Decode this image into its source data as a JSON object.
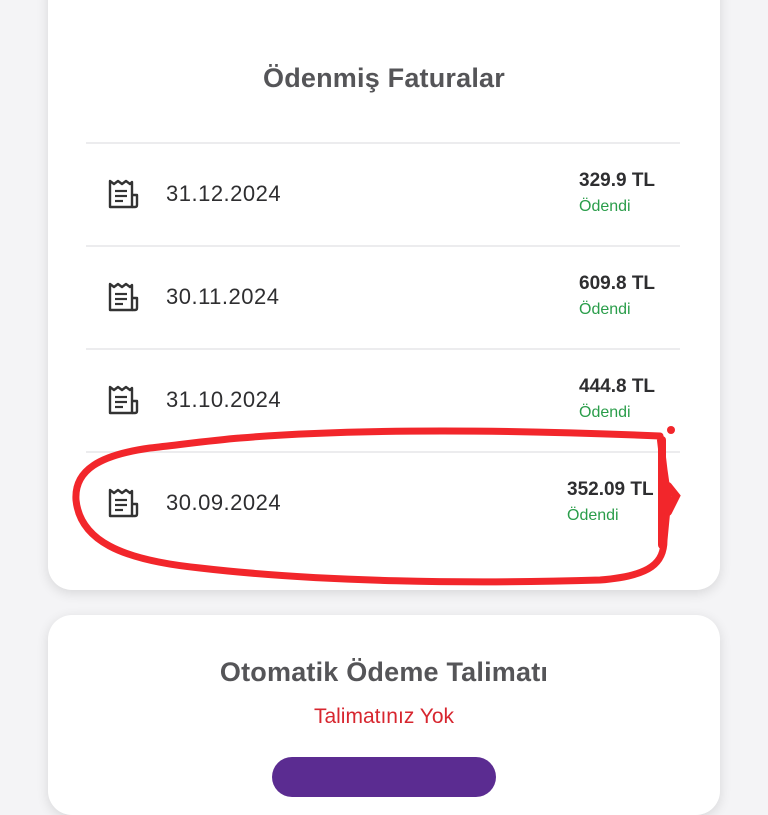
{
  "paid_invoices": {
    "title": "Ödenmiş Faturalar",
    "items": [
      {
        "date": "31.12.2024",
        "amount": "329.9 TL",
        "status": "Ödendi"
      },
      {
        "date": "30.11.2024",
        "amount": "609.8 TL",
        "status": "Ödendi"
      },
      {
        "date": "31.10.2024",
        "amount": "444.8 TL",
        "status": "Ödendi"
      },
      {
        "date": "30.09.2024",
        "amount": "352.09 TL",
        "status": "Ödendi"
      }
    ]
  },
  "auto_payment": {
    "title": "Otomatik Ödeme Talimatı",
    "status": "Talimatınız Yok"
  },
  "colors": {
    "primary": "#5b2c91",
    "paid_status": "#2a9d4a",
    "no_order": "#d7262f",
    "annotation": "#f2262b"
  },
  "icons": {
    "invoice": "receipt-icon"
  }
}
